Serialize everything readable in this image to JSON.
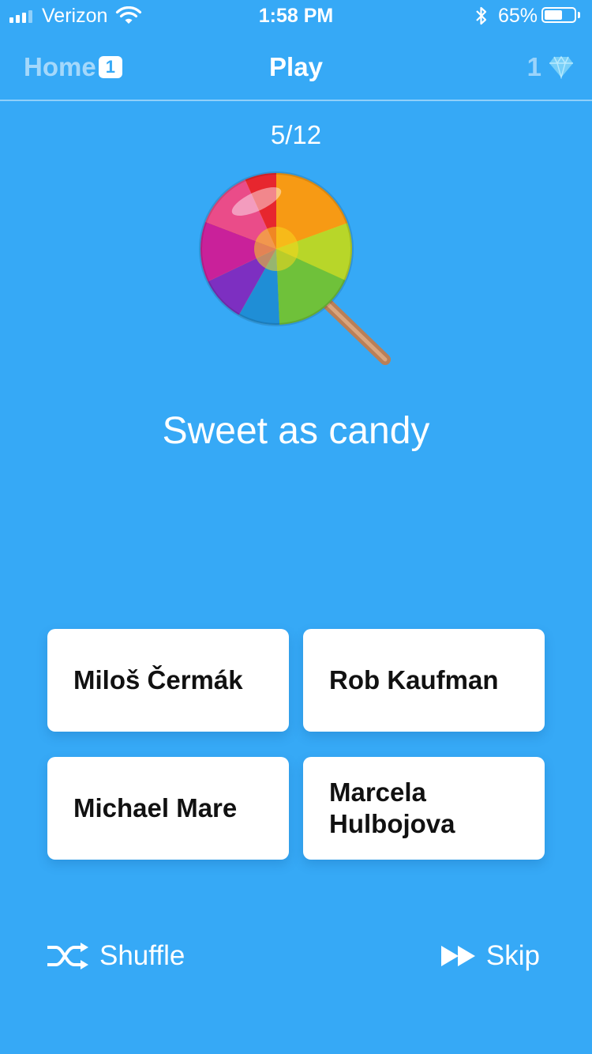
{
  "status_bar": {
    "carrier": "Verizon",
    "time": "1:58 PM",
    "battery_percent": "65%",
    "battery_level": 0.65
  },
  "nav": {
    "home_label": "Home",
    "home_badge": "1",
    "title": "Play",
    "gems_count": "1"
  },
  "game": {
    "progress": "5/12",
    "emoji_icon": "lollipop-icon",
    "clue": "Sweet as candy",
    "answers": [
      "Miloš Čermák",
      "Rob Kaufman",
      "Michael Mare",
      "Marcela Hulbojova"
    ]
  },
  "actions": {
    "shuffle_label": "Shuffle",
    "skip_label": "Skip"
  },
  "colors": {
    "background": "#36A9F6",
    "card": "#FFFFFF",
    "text": "#111111"
  }
}
